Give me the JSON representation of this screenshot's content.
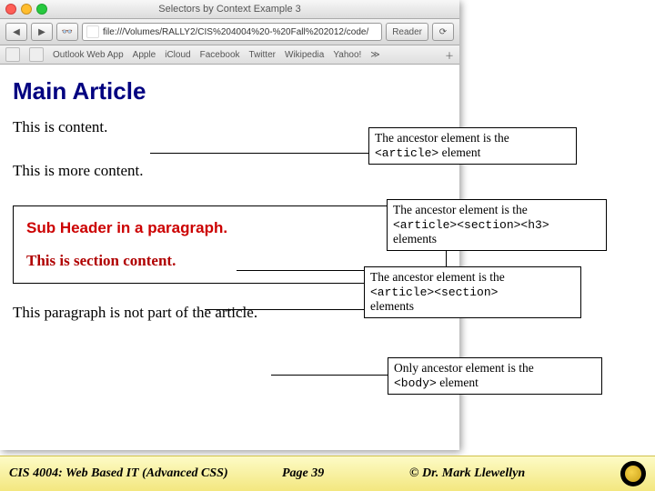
{
  "browser": {
    "window_title": "Selectors by Context Example 3",
    "url": "file:///Volumes/RALLY2/CIS%204004%20-%20Fall%202012/code/",
    "reader_label": "Reader",
    "bookmarks": [
      "Outlook Web App",
      "Apple",
      "iCloud",
      "Facebook",
      "Twitter",
      "Wikipedia",
      "Yahoo!"
    ]
  },
  "page": {
    "heading": "Main Article",
    "p1": "This is content.",
    "p2": "This is more content.",
    "sub_header": "Sub Header in a paragraph.",
    "section_content": "This is section content.",
    "outside": "This paragraph is not part of the article."
  },
  "callouts": {
    "c1_a": "The ancestor element is the",
    "c1_b": "<article>",
    "c1_c": " element",
    "c2_a": "The ancestor element is the",
    "c2_b": "<article><section><h3>",
    "c2_c": "elements",
    "c3_a": "The ancestor element is the",
    "c3_b": "<article><section>",
    "c3_c": "elements",
    "c4_a": "Only ancestor element is the",
    "c4_b": "<body>",
    "c4_c": " element"
  },
  "footer": {
    "course": "CIS 4004: Web Based IT (Advanced CSS)",
    "page": "Page 39",
    "author": "© Dr. Mark Llewellyn"
  }
}
